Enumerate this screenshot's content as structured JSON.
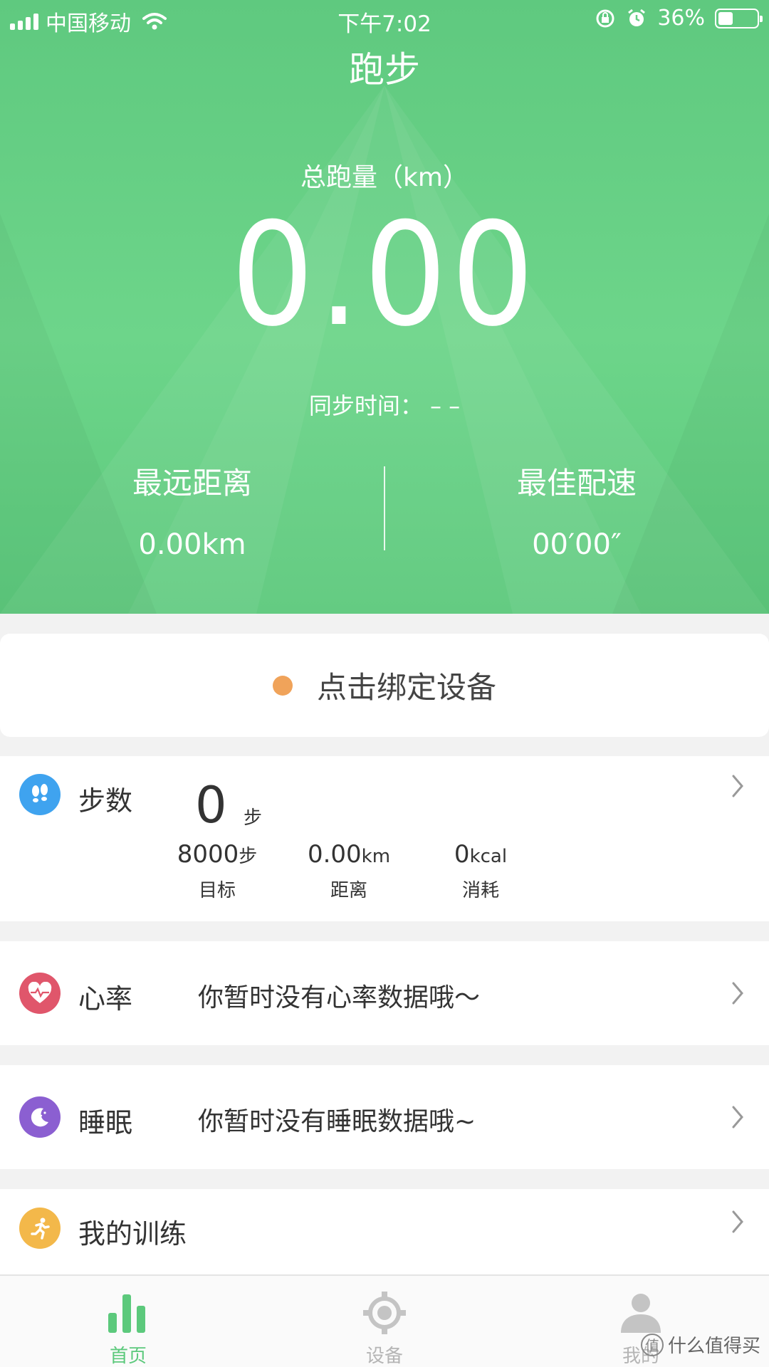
{
  "status_bar": {
    "carrier": "中国移动",
    "time": "下午7:02",
    "battery": "36%"
  },
  "header": {
    "title": "跑步"
  },
  "summary": {
    "total_label": "总跑量（km）",
    "total_value": "0.00",
    "sync_label": "同步时间：",
    "sync_value": "– –",
    "farthest_label": "最远距离",
    "farthest_value": "0.00km",
    "best_pace_label": "最佳配速",
    "best_pace_value": "00′00″"
  },
  "bind_card": {
    "label": "点击绑定设备"
  },
  "steps_card": {
    "title": "步数",
    "count": "0",
    "count_unit": "步",
    "goal_value": "8000",
    "goal_unit": "步",
    "goal_label": "目标",
    "distance_value": "0.00",
    "distance_unit": "km",
    "distance_label": "距离",
    "calorie_value": "0",
    "calorie_unit": "kcal",
    "calorie_label": "消耗"
  },
  "heart_card": {
    "title": "心率",
    "message": "你暂时没有心率数据哦～"
  },
  "sleep_card": {
    "title": "睡眠",
    "message": "你暂时没有睡眠数据哦~"
  },
  "training_card": {
    "title": "我的训练"
  },
  "tab_bar": {
    "home": "首页",
    "device": "设备",
    "me": "我的"
  },
  "watermark": {
    "badge": "值",
    "text": "什么值得买"
  },
  "colors": {
    "hero_green": "#66cf85",
    "accent_green": "#5cc97c",
    "steps_blue": "#3fa3ef",
    "heart_red": "#e0566b",
    "sleep_purple": "#8b5fd1",
    "training_yellow": "#f3b84a",
    "bind_dot_orange": "#f0a35a"
  },
  "icons": {
    "steps": "footprints-icon",
    "heart": "heartbeat-icon",
    "sleep": "moon-icon",
    "training": "runner-icon",
    "home_tab": "bar-chart-icon",
    "device_tab": "watch-icon",
    "me_tab": "person-icon"
  }
}
